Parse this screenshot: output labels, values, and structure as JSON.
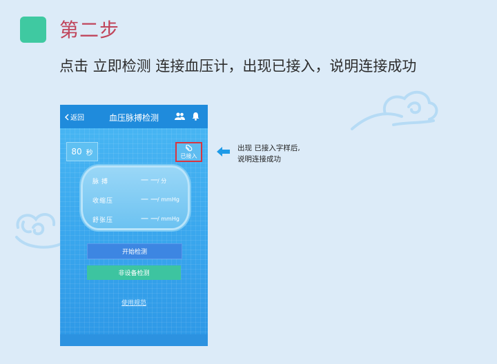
{
  "step": {
    "title": "第二步"
  },
  "instruction": "点击 立即检测 连接血压计，出现已接入，说明连接成功",
  "colors": {
    "accent_green": "#3fc9a1",
    "title_red": "#c0455b",
    "phone_blue": "#3ba8ee",
    "highlight_red": "#d9343f"
  },
  "phone": {
    "back_label": "返回",
    "back_icon": "chevron-left-icon",
    "title": "血压脉搏检测",
    "header_icons": [
      "people-icon",
      "bell-icon"
    ],
    "timer": {
      "value": "80",
      "unit": "秒"
    },
    "connection": {
      "label": "已接入",
      "icon": "paperclip-icon"
    },
    "readings": [
      {
        "label": "脉搏",
        "value": "一一",
        "unit": "/ 分"
      },
      {
        "label": "收缩压",
        "value": "一一",
        "unit": "/ mmHg"
      },
      {
        "label": "舒张压",
        "value": "一一",
        "unit": "/ mmHg"
      }
    ],
    "start_button": "开始检测",
    "non_device_button": "非设备检测",
    "usage_link": "使用规范"
  },
  "callout": {
    "line1": "出现 已接入字样后,",
    "line2": "说明连接成功",
    "icon": "arrow-left-icon"
  }
}
